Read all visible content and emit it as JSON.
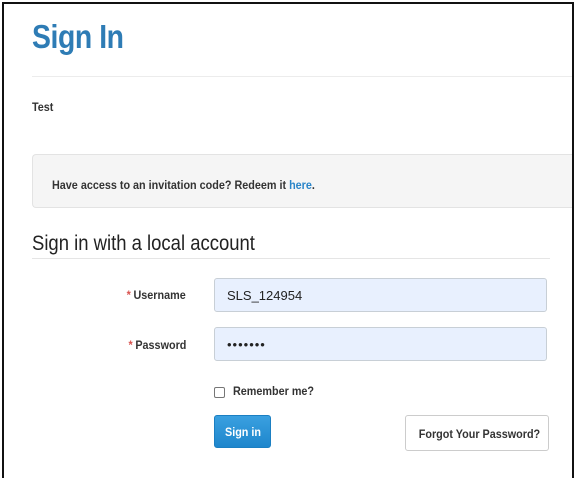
{
  "page": {
    "title": "Sign In",
    "tenant_name": "Test"
  },
  "invitation": {
    "text": "Have access to an invitation code? Redeem it ",
    "link_label": "here",
    "suffix": "."
  },
  "local_account": {
    "heading": "Sign in with a local account",
    "username": {
      "required_marker": "*",
      "label": "Username",
      "value": "SLS_124954"
    },
    "password": {
      "required_marker": "*",
      "label": "Password",
      "masked_value": "•••••••"
    },
    "remember_me": {
      "label": "Remember me?",
      "checked": false
    },
    "signin_label": "Sign in",
    "forgot_label": "Forgot Your Password?"
  },
  "colors": {
    "title": "#2e7cb5",
    "link": "#2a85c9",
    "primary_button": "#1e86cc",
    "required_marker": "#d9534f",
    "input_autofill_bg": "#e8f0fe"
  }
}
